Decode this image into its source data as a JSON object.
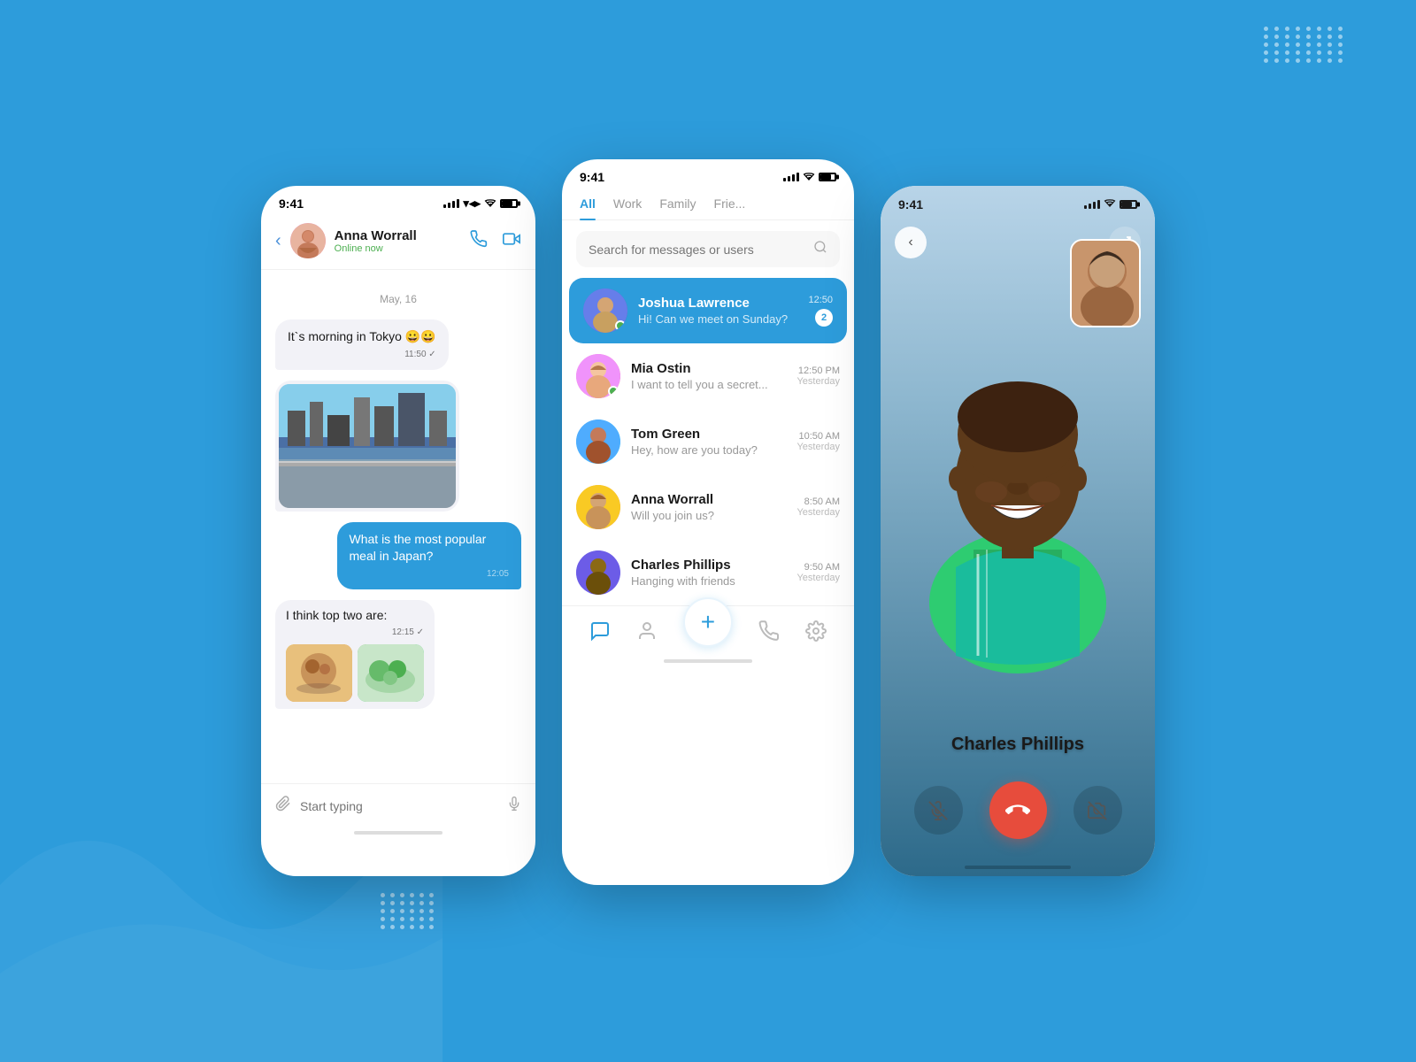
{
  "background": {
    "color": "#2d9cdb"
  },
  "phone_left": {
    "status_time": "9:41",
    "header": {
      "user_name": "Anna Worrall",
      "status": "Online now"
    },
    "date_label": "May, 16",
    "messages": [
      {
        "id": 1,
        "type": "received",
        "text": "It`s morning in Tokyo 😀😀",
        "time": "11:50"
      },
      {
        "id": 2,
        "type": "received",
        "text": "[image:tokyo]",
        "time": ""
      },
      {
        "id": 3,
        "type": "sent",
        "text": "What is the most popular meal in Japan?",
        "time": "12:05"
      },
      {
        "id": 4,
        "type": "received",
        "text": "I think top two are:",
        "time": "12:15"
      },
      {
        "id": 5,
        "type": "received",
        "text": "[images:food]",
        "time": ""
      }
    ],
    "input_placeholder": "Start typing"
  },
  "phone_center": {
    "status_time": "9:41",
    "tabs": [
      "All",
      "Work",
      "Family",
      "Frie..."
    ],
    "active_tab": "All",
    "search_placeholder": "Search for messages or users",
    "contacts": [
      {
        "id": 1,
        "name": "Joshua Lawrence",
        "preview": "Hi! Can we meet on Sunday?",
        "time": "12:50",
        "unread": 2,
        "active": true,
        "online": true
      },
      {
        "id": 2,
        "name": "Mia Ostin",
        "preview": "I want to tell you a secret...",
        "time": "12:50 PM",
        "time2": "Yesterday",
        "unread": 0,
        "active": false,
        "online": true
      },
      {
        "id": 3,
        "name": "Tom Green",
        "preview": "Hey, how are you today?",
        "time": "10:50 AM",
        "time2": "Yesterday",
        "unread": 0,
        "active": false,
        "online": false
      },
      {
        "id": 4,
        "name": "Anna Worrall",
        "preview": "Will you join us?",
        "time": "8:50 AM",
        "time2": "Yesterday",
        "unread": 0,
        "active": false,
        "online": false
      },
      {
        "id": 5,
        "name": "Charles Phillips",
        "preview": "Hanging with friends",
        "time": "9:50 AM",
        "time2": "Yesterday",
        "unread": 0,
        "active": false,
        "online": false
      }
    ],
    "fab_label": "+"
  },
  "phone_right": {
    "status_time": "9:41",
    "caller_name": "Charles Phillips",
    "controls": {
      "mute": "🎤",
      "end_call": "📞",
      "video_off": "📹"
    }
  }
}
